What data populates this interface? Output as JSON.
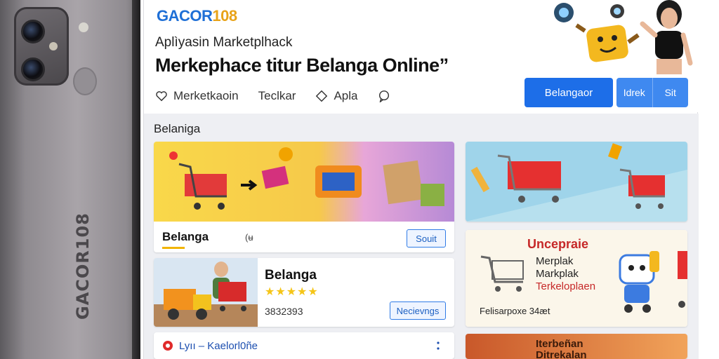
{
  "phone": {
    "brand": "GACOR108"
  },
  "header": {
    "logo_main": "GACOR",
    "logo_accent": "108",
    "subtitle": "Aplìyasin Marketplhack",
    "headline": "Merkephace titur Belanga Online”"
  },
  "nav": {
    "items": [
      {
        "label": "Merketkaoin",
        "icon": "heart-icon"
      },
      {
        "label": "Teclkar",
        "icon": ""
      },
      {
        "label": "Apla",
        "icon": "tag-icon"
      },
      {
        "label": "",
        "icon": "chat-icon"
      }
    ]
  },
  "actions": {
    "primary_label": "Belangaor",
    "split_left": "Idrek",
    "split_right": "Sit"
  },
  "content": {
    "section_title": "Belaniga",
    "card1": {
      "label": "Belanga",
      "mark": "(ʉ",
      "button": "Souit"
    },
    "card2": {
      "title": "Belanga",
      "stars": "★★★★★",
      "number": "3832393",
      "button": "Necievngs"
    },
    "card3": {
      "label": "Lyıı – Kaelorl0ñe"
    },
    "promo": {
      "title": "Uncepraie",
      "line1": "Merplak",
      "line2": "Markplak",
      "line3": "Terkeloplaen",
      "footer": "Felisarpoxe  34æt"
    },
    "promo2": {
      "line1": "Iterbeñan",
      "line2": "Ditrekalan"
    }
  },
  "colors": {
    "primary": "#1d6ee8",
    "accent_yellow": "#e8a319",
    "promo_red": "#c62828"
  }
}
